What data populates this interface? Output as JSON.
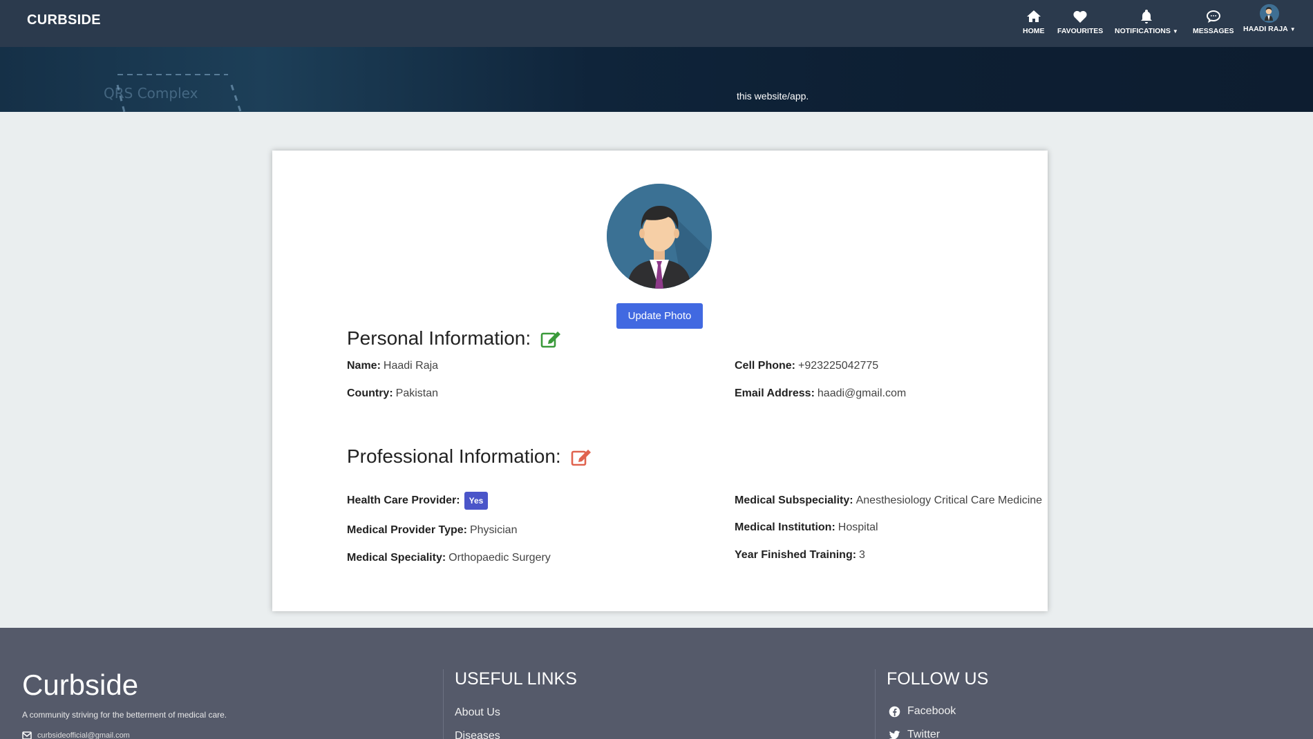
{
  "header": {
    "brand": "CURBSIDE",
    "nav": {
      "home": "HOME",
      "favourites": "FAVOURITES",
      "notifications": "NOTIFICATIONS",
      "messages": "MESSAGES",
      "user": "HAADI RAJA"
    }
  },
  "hero": {
    "text": "this website/app.",
    "deco_text": "QRS Complex",
    "deco_letter": "R"
  },
  "profile": {
    "update_photo": "Update Photo",
    "personal": {
      "title": "Personal Information:",
      "name_label": "Name:",
      "name": "Haadi Raja",
      "country_label": "Country:",
      "country": "Pakistan",
      "phone_label": "Cell Phone:",
      "phone": "+923225042775",
      "email_label": "Email Address:",
      "email": "haadi@gmail.com"
    },
    "professional": {
      "title": "Professional Information:",
      "hcp_label": "Health Care Provider:",
      "hcp": "Yes",
      "provider_type_label": "Medical Provider Type:",
      "provider_type": "Physician",
      "speciality_label": "Medical Speciality:",
      "speciality": "Orthopaedic Surgery",
      "subspeciality_label": "Medical Subspeciality:",
      "subspeciality": "Anesthesiology Critical Care Medicine",
      "institution_label": "Medical Institution:",
      "institution": "Hospital",
      "year_label": "Year Finished Training:",
      "year": "3"
    }
  },
  "footer": {
    "brand": "Curbside",
    "tagline": "A community striving for the betterment of medical care.",
    "email": "curbsideofficial@gmail.com",
    "useful_links_title": "USEFUL LINKS",
    "useful_links": [
      "About Us",
      "Diseases"
    ],
    "follow_title": "FOLLOW US",
    "social": [
      "Facebook",
      "Twitter"
    ]
  },
  "colors": {
    "navbar": "#2b3a4d",
    "primary_button": "#4169e1",
    "edit_personal": "#3a9a3a",
    "edit_professional": "#e0634f",
    "badge": "#4a55c9",
    "footer": "#555a6a"
  }
}
